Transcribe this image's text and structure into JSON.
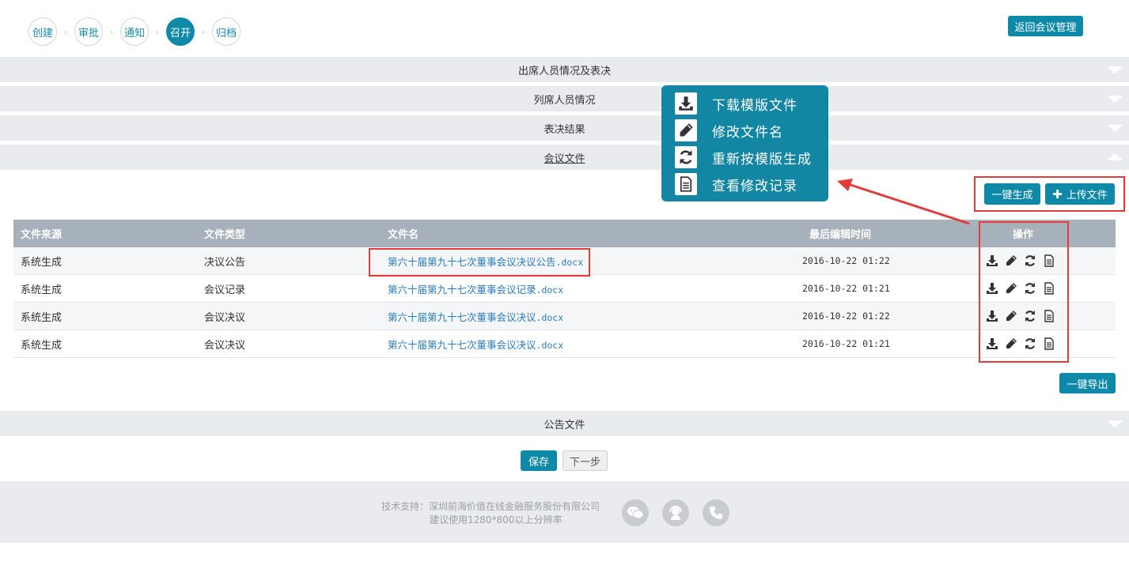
{
  "steps": [
    "创建",
    "审批",
    "通知",
    "召开",
    "归档"
  ],
  "active_step": "召开",
  "back_button": "返回会议管理",
  "sections": {
    "attendance_vote": "出席人员情况及表决",
    "observers": "列席人员情况",
    "vote_result": "表决结果",
    "meeting_files": "会议文件",
    "announcement_files": "公告文件"
  },
  "actions": {
    "generate_all": "一键生成",
    "upload": "上传文件",
    "export_all": "一键导出"
  },
  "table": {
    "headers": [
      "文件来源",
      "文件类型",
      "文件名",
      "最后编辑时间",
      "操作"
    ],
    "rows": [
      {
        "source": "系统生成",
        "type": "决议公告",
        "name_cn": "第六十届第九十七次董事会议决议公告",
        "ext": ".docx",
        "time": "2016-10-22 01:22"
      },
      {
        "source": "系统生成",
        "type": "会议记录",
        "name_cn": "第六十届第九十七次董事会议记录",
        "ext": ".docx",
        "time": "2016-10-22 01:21"
      },
      {
        "source": "系统生成",
        "type": "会议决议",
        "name_cn": "第六十届第九十七次董事会议决议",
        "ext": ".docx",
        "time": "2016-10-22 01:22"
      },
      {
        "source": "系统生成",
        "type": "会议决议",
        "name_cn": "第六十届第九十七次董事会议决议",
        "ext": ".docx",
        "time": "2016-10-22 01:21"
      }
    ]
  },
  "tooltip": {
    "items": [
      {
        "icon": "download-icon",
        "label": "下载模版文件"
      },
      {
        "icon": "pencil-icon",
        "label": "修改文件名"
      },
      {
        "icon": "refresh-icon",
        "label": "重新按模版生成"
      },
      {
        "icon": "document-icon",
        "label": "查看修改记录"
      }
    ]
  },
  "bottom": {
    "save": "保存",
    "next": "下一步"
  },
  "footer": {
    "support": "技术支持：深圳前海价值在线金融服务股份有限公司",
    "resolution": "建议使用1280*800以上分辨率",
    "icons": [
      "wechat-icon",
      "customer-service-icon",
      "phone-icon"
    ]
  },
  "colors": {
    "primary": "#0f89a8",
    "highlight": "#e53a3a",
    "link": "#2a7cc0"
  }
}
